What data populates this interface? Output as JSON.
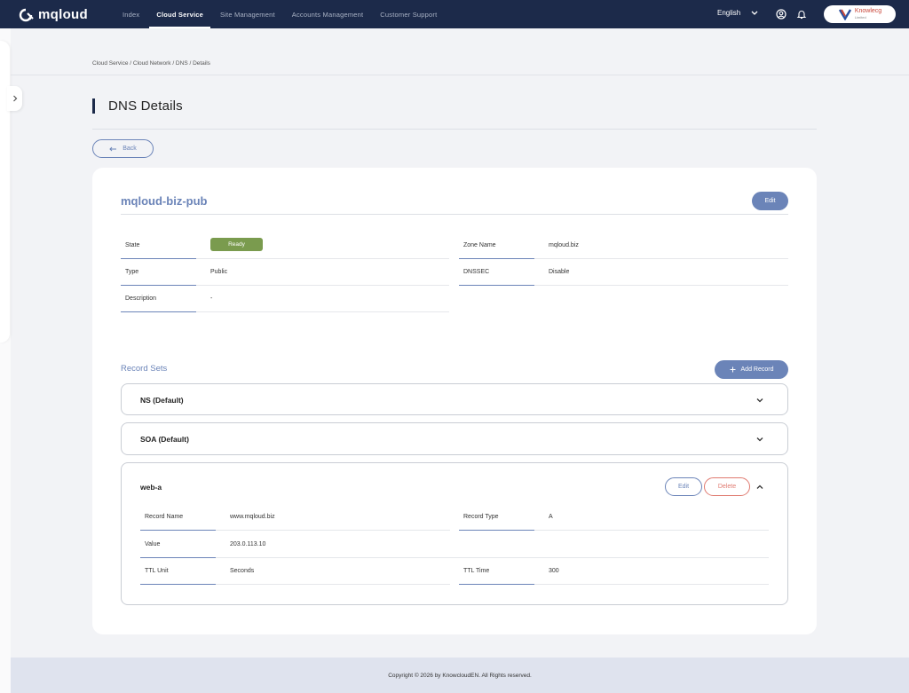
{
  "nav": {
    "logo": "mqloud",
    "items": [
      {
        "label": "Index",
        "active": false
      },
      {
        "label": "Cloud Service",
        "active": true
      },
      {
        "label": "Site Management",
        "active": false
      },
      {
        "label": "Accounts Management",
        "active": false
      },
      {
        "label": "Customer Support",
        "active": false
      }
    ],
    "language": "English",
    "brand": {
      "name": "Knowlecg",
      "sub": "Limited"
    }
  },
  "breadcrumb": "Cloud Service / Cloud Network / DNS / Details",
  "page_title": "DNS Details",
  "back_label": "Back",
  "zone": {
    "name": "mqloud-biz-pub",
    "edit_label": "Edit",
    "details": {
      "state_label": "State",
      "state_value": "Ready",
      "zone_name_label": "Zone Name",
      "zone_name_value": "mqloud.biz",
      "type_label": "Type",
      "type_value": "Public",
      "dnssec_label": "DNSSEC",
      "dnssec_value": "Disable",
      "description_label": "Description",
      "description_value": "-"
    }
  },
  "record_sets": {
    "title": "Record Sets",
    "add_label": "Add Record",
    "collapsed": [
      {
        "name": "NS (Default)"
      },
      {
        "name": "SOA (Default)"
      }
    ],
    "expanded": {
      "name": "web-a",
      "edit_label": "Edit",
      "delete_label": "Delete",
      "fields": {
        "record_name_label": "Record Name",
        "record_name_value": "www.mqloud.biz",
        "record_type_label": "Record Type",
        "record_type_value": "A",
        "value_label": "Value",
        "value_value": "203.0.113.10",
        "ttl_unit_label": "TTL Unit",
        "ttl_unit_value": "Seconds",
        "ttl_time_label": "TTL Time",
        "ttl_time_value": "300"
      }
    }
  },
  "footer": "Copyright © 2026 by KnowcloudEN. All Rights reserved.",
  "colors": {
    "nav_bg": "#1c2a4a",
    "accent": "#6b84b8",
    "ready": "#7a9b4e",
    "danger": "#e07a70"
  }
}
